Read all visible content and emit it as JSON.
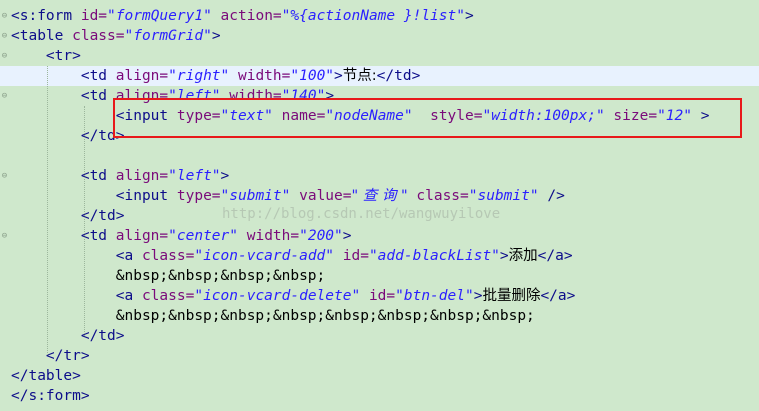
{
  "lines": [
    {
      "fold": "⊖",
      "parts": [
        [
          "t",
          "<s:form "
        ],
        [
          "a",
          "id="
        ],
        [
          "v",
          "\"formQuery1\""
        ],
        [
          "a",
          " action="
        ],
        [
          "v",
          "\"%{actionName }!list\""
        ],
        [
          "t",
          ">"
        ]
      ]
    },
    {
      "fold": "⊖",
      "parts": [
        [
          "t",
          "<table "
        ],
        [
          "a",
          "class="
        ],
        [
          "v",
          "\"formGrid\""
        ],
        [
          "t",
          ">"
        ]
      ]
    },
    {
      "fold": "⊖",
      "parts": [
        [
          "t",
          "    <tr>"
        ]
      ]
    },
    {
      "fold": "",
      "highlight": true,
      "parts": [
        [
          "t",
          "        <td "
        ],
        [
          "a",
          "align="
        ],
        [
          "v",
          "\"right\""
        ],
        [
          "a",
          " width="
        ],
        [
          "v",
          "\"100\""
        ],
        [
          "t",
          ">"
        ],
        [
          "tx",
          "节点:"
        ],
        [
          "t",
          "</td>"
        ]
      ]
    },
    {
      "fold": "⊖",
      "parts": [
        [
          "t",
          "        <td "
        ],
        [
          "a",
          "align="
        ],
        [
          "v",
          "\"left\""
        ],
        [
          "a",
          " width="
        ],
        [
          "v",
          "\"140\""
        ],
        [
          "t",
          ">"
        ]
      ]
    },
    {
      "fold": "",
      "parts": [
        [
          "t",
          "            <input "
        ],
        [
          "a",
          "type="
        ],
        [
          "v",
          "\"text\""
        ],
        [
          "a",
          " name="
        ],
        [
          "v",
          "\"nodeName\""
        ],
        [
          "a",
          "  style="
        ],
        [
          "v",
          "\"width:100px;\""
        ],
        [
          "a",
          " size="
        ],
        [
          "v",
          "\"12\""
        ],
        [
          "t",
          " >"
        ]
      ]
    },
    {
      "fold": "",
      "parts": [
        [
          "t",
          "        </td>"
        ]
      ]
    },
    {
      "fold": "",
      "parts": []
    },
    {
      "fold": "⊖",
      "parts": [
        [
          "t",
          "        <td "
        ],
        [
          "a",
          "align="
        ],
        [
          "v",
          "\"left\""
        ],
        [
          "t",
          ">"
        ]
      ]
    },
    {
      "fold": "",
      "parts": [
        [
          "t",
          "            <input "
        ],
        [
          "a",
          "type="
        ],
        [
          "v",
          "\"submit\""
        ],
        [
          "a",
          " value="
        ],
        [
          "v",
          "\" 查 询 \""
        ],
        [
          "a",
          " class="
        ],
        [
          "v",
          "\"submit\""
        ],
        [
          "t",
          " />"
        ]
      ]
    },
    {
      "fold": "",
      "parts": [
        [
          "t",
          "        </td>"
        ]
      ]
    },
    {
      "fold": "⊖",
      "parts": [
        [
          "t",
          "        <td "
        ],
        [
          "a",
          "align="
        ],
        [
          "v",
          "\"center\""
        ],
        [
          "a",
          " width="
        ],
        [
          "v",
          "\"200\""
        ],
        [
          "t",
          ">"
        ]
      ]
    },
    {
      "fold": "",
      "parts": [
        [
          "t",
          "            <a "
        ],
        [
          "a",
          "class="
        ],
        [
          "v",
          "\"icon-vcard-add\""
        ],
        [
          "a",
          " id="
        ],
        [
          "v",
          "\"add-blackList\""
        ],
        [
          "t",
          ">"
        ],
        [
          "tx",
          "添加"
        ],
        [
          "t",
          "</a>"
        ]
      ]
    },
    {
      "fold": "",
      "parts": [
        [
          "tx",
          "            &nbsp;&nbsp;&nbsp;&nbsp;"
        ]
      ]
    },
    {
      "fold": "",
      "parts": [
        [
          "t",
          "            <a "
        ],
        [
          "a",
          "class="
        ],
        [
          "v",
          "\"icon-vcard-delete\""
        ],
        [
          "a",
          " id="
        ],
        [
          "v",
          "\"btn-del\""
        ],
        [
          "t",
          ">"
        ],
        [
          "tx",
          "批量删除"
        ],
        [
          "t",
          "</a>"
        ]
      ]
    },
    {
      "fold": "",
      "parts": [
        [
          "tx",
          "            &nbsp;&nbsp;&nbsp;&nbsp;&nbsp;&nbsp;&nbsp;&nbsp;"
        ]
      ]
    },
    {
      "fold": "",
      "parts": [
        [
          "t",
          "        </td>"
        ]
      ]
    },
    {
      "fold": "",
      "parts": [
        [
          "t",
          "    </tr>"
        ]
      ]
    },
    {
      "fold": "",
      "parts": [
        [
          "t",
          "</table>"
        ]
      ]
    },
    {
      "fold": "",
      "parts": [
        [
          "t",
          "</s:form>"
        ]
      ]
    }
  ],
  "watermark": "http://blog.csdn.net/wangwuyilove"
}
